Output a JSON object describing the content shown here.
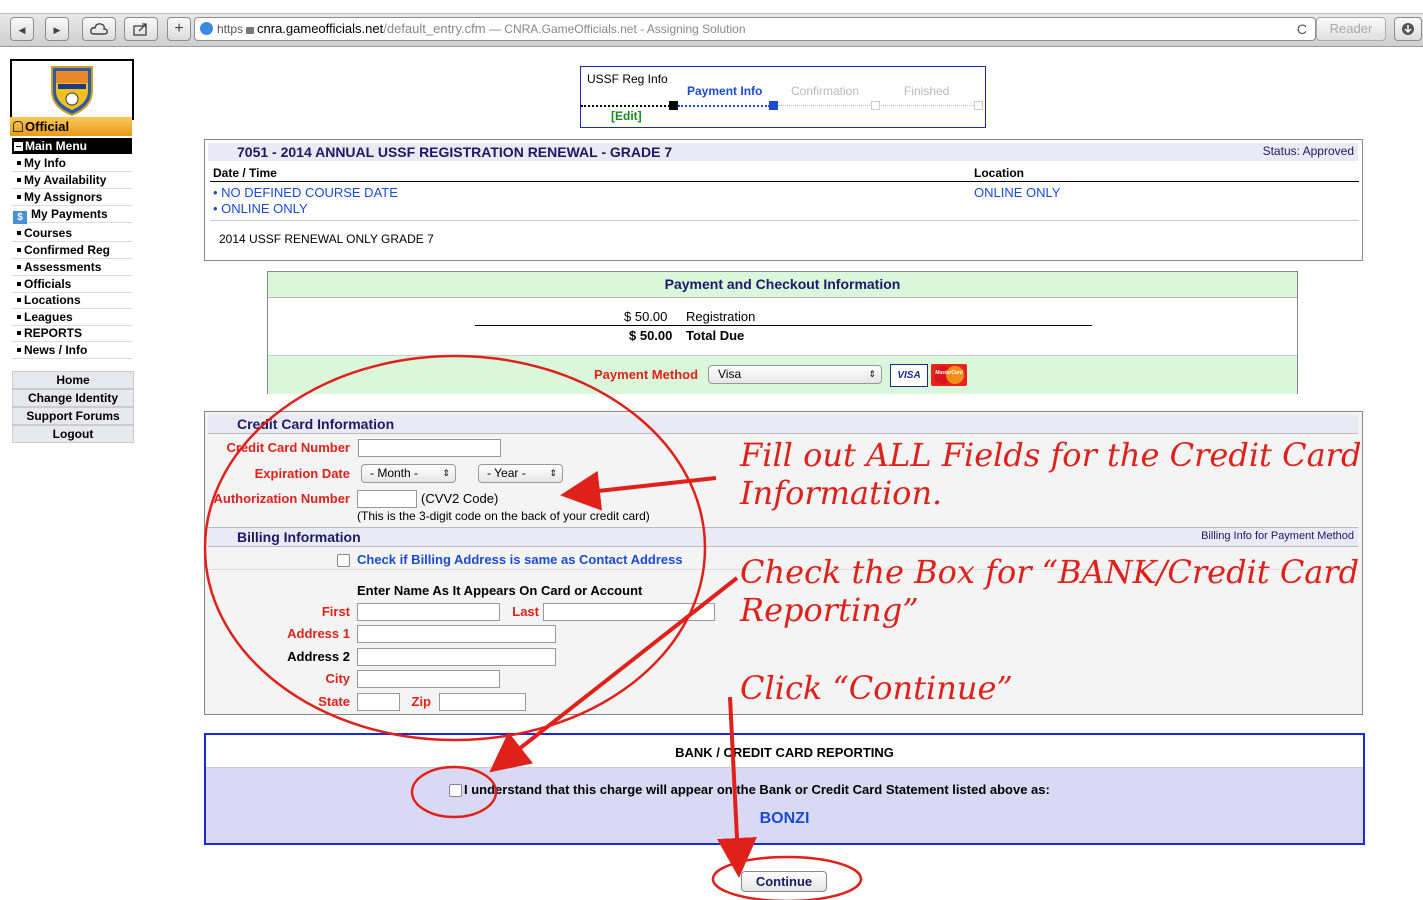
{
  "browser": {
    "url_scheme": "https",
    "url_domain": "cnra.gameofficials.net",
    "url_path": "/default_entry.cfm",
    "page_title": "— CNRA.GameOfficials.net - Assigning Solution",
    "reader_label": "Reader",
    "back_glyph": "◀",
    "forward_glyph": "▶",
    "add_glyph": "+",
    "reload_glyph": "C"
  },
  "sidebar": {
    "role_label": "Official",
    "main_menu_label": "Main Menu",
    "items": [
      "My Info",
      "My Availability",
      "My Assignors",
      "My Payments",
      "Courses",
      "Confirmed Reg",
      "Assessments",
      "Officials",
      "Locations",
      "Leagues",
      "REPORTS",
      "News / Info"
    ],
    "links": [
      "Home",
      "Change Identity",
      "Support Forums",
      "Logout"
    ]
  },
  "progress": {
    "step1": "USSF Reg Info",
    "step1_edit": "[Edit]",
    "step2": "Payment Info",
    "step3": "Confirmation",
    "step4": "Finished"
  },
  "course": {
    "title": "7051 - 2014 ANNUAL USSF REGISTRATION RENEWAL - GRADE 7",
    "status": "Status: Approved",
    "col_datetime": "Date / Time",
    "col_location": "Location",
    "date_line1": "• NO DEFINED COURSE DATE",
    "date_line2": "• ONLINE ONLY",
    "location": "ONLINE ONLY",
    "description": "2014 USSF RENEWAL ONLY GRADE 7"
  },
  "payment": {
    "header": "Payment and Checkout Information",
    "reg_amount": "$ 50.00",
    "reg_label": "Registration",
    "total_amount": "$ 50.00",
    "total_label": "Total Due",
    "method_label": "Payment Method",
    "method_value": "Visa",
    "visa_logo": "VISA",
    "mc_logo": "MasterCard"
  },
  "credit_card": {
    "section_title": "Credit Card Information",
    "number_label": "Credit Card Number",
    "exp_label": "Expiration Date",
    "month_placeholder": "- Month -",
    "year_placeholder": "- Year -",
    "auth_label": "Authorization Number",
    "cvv_label": "(CVV2 Code)",
    "cvv_help": "(This is the 3-digit code on the back of your credit card)"
  },
  "billing": {
    "section_title": "Billing Information",
    "right_note": "Billing Info for Payment Method",
    "same_as_contact": "Check if Billing Address is same as Contact Address",
    "name_heading": "Enter Name As It Appears On Card or Account",
    "first_label": "First",
    "last_label": "Last",
    "address1_label": "Address 1",
    "address2_label": "Address 2",
    "city_label": "City",
    "state_label": "State",
    "zip_label": "Zip"
  },
  "bank": {
    "header": "BANK / CREDIT CARD REPORTING",
    "statement": "I understand that this charge will appear on the Bank or Credit Card Statement listed above as:",
    "name": "BONZI"
  },
  "continue_label": "Continue",
  "annotations": {
    "a1": "Fill out ALL Fields for the Credit Card Information.",
    "a2": "Check the Box for “BANK/Credit Card Reporting”",
    "a3": "Click “Continue”"
  },
  "colors": {
    "annotation_red": "#e0201a",
    "link_blue": "#1a4bd6",
    "highlight_green": "#dbf7db",
    "bank_bg": "#d9d9f4",
    "bank_border": "#1a2bd6"
  }
}
